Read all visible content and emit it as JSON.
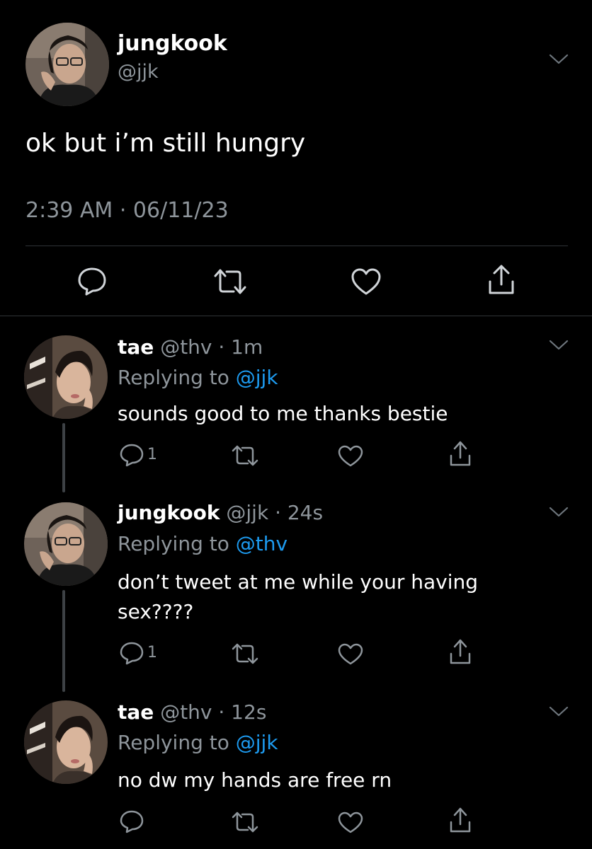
{
  "main_tweet": {
    "name": "jungkook",
    "handle": "@jjk",
    "text": "ok but i’m still hungry",
    "timestamp": "2:39 AM · 06/11/23",
    "actions": [
      "reply-icon",
      "retweet-icon",
      "like-icon",
      "share-icon"
    ]
  },
  "replies": [
    {
      "name": "tae",
      "handle_time": "@thv · 1m",
      "replying_prefix": "Replying to ",
      "replying_to": "@jjk",
      "text": "sounds good to me thanks bestie",
      "reply_count": "1"
    },
    {
      "name": "jungkook",
      "handle_time": "@jjk · 24s",
      "replying_prefix": "Replying to ",
      "replying_to": "@thv",
      "text": "don’t tweet at me while your having sex????",
      "reply_count": "1"
    },
    {
      "name": "tae",
      "handle_time": "@thv · 12s",
      "replying_prefix": "Replying to ",
      "replying_to": "@jjk",
      "text": "no dw my hands are free rn",
      "reply_count": ""
    }
  ],
  "colors": {
    "background": "#000000",
    "secondary_text": "#8e959b",
    "mention": "#1d9bf0",
    "divider": "#2f3336"
  }
}
